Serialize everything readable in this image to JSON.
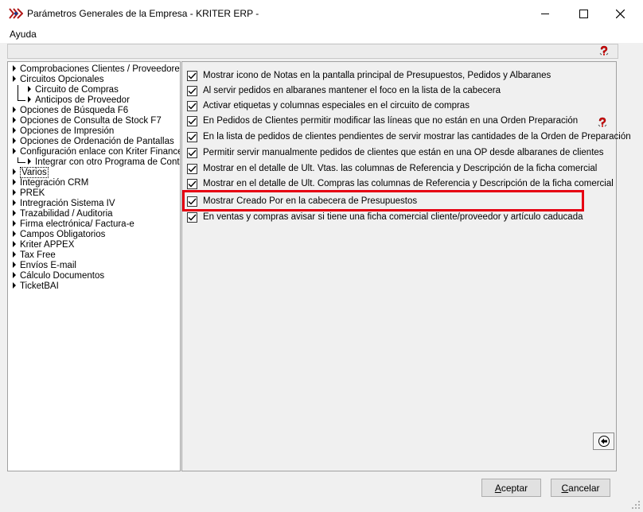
{
  "window": {
    "title": "Parámetros Generales de la Empresa - KRITER ERP -"
  },
  "menu": {
    "items": [
      "Ayuda"
    ]
  },
  "tree": {
    "items": [
      "Comprobaciones Clientes / Proveedores",
      "Circuitos Opcionales",
      "Circuito de Compras",
      "Anticipos de Proveedor",
      "Opciones de Búsqueda F6",
      "Opciones de Consulta de Stock F7",
      "Opciones de Impresión",
      "Opciones de Ordenación de Pantallas",
      "Configuración enlace con Kriter Finances",
      "Integrar con otro Programa de Contabi",
      "Varios",
      "Integración CRM",
      "PREK",
      "Intregración Sistema IV",
      "Trazabilidad / Auditoria",
      "Firma electrónica/ Factura-e",
      "Campos Obligatorios",
      "Kriter APPEX",
      "Tax Free",
      "Envíos E-mail",
      "Cálculo Documentos",
      "TicketBAI"
    ]
  },
  "options": [
    {
      "label": "Mostrar icono de Notas en la pantalla principal de Presupuestos, Pedidos y Albaranes",
      "checked": true
    },
    {
      "label": "Al servir pedidos en albaranes mantener el foco en la lista de la cabecera",
      "checked": true
    },
    {
      "label": "Activar etiquetas y columnas especiales en el circuito de compras",
      "checked": true
    },
    {
      "label": "En Pedidos de Clientes permitir modificar las líneas que no están en una Orden Preparación",
      "checked": true
    },
    {
      "label": "En la lista de pedidos de clientes pendientes de servir mostrar las cantidades de la Orden de Preparación",
      "checked": true
    },
    {
      "label": "Permitir servir manualmente pedidos de clientes que están en una OP desde albaranes de clientes",
      "checked": true
    },
    {
      "label": "Mostrar en el detalle de Ult. Vtas. las columnas de Referencia y Descripción de la ficha comercial",
      "checked": true
    },
    {
      "label": "Mostrar en el detalle de Ult. Compras las columnas de Referencia y Descripción de la ficha comercial",
      "checked": true
    },
    {
      "label": "Mostrar Creado Por en la cabecera de Presupuestos",
      "checked": true
    },
    {
      "label": "En ventas y compras avisar si tiene una ficha comercial cliente/proveedor y artículo caducada",
      "checked": true
    }
  ],
  "buttons": {
    "accept_first": "A",
    "accept_rest": "ceptar",
    "cancel_first": "C",
    "cancel_rest": "ancelar"
  },
  "colors": {
    "highlight": "#e60012",
    "help_icon": "#d40000"
  }
}
